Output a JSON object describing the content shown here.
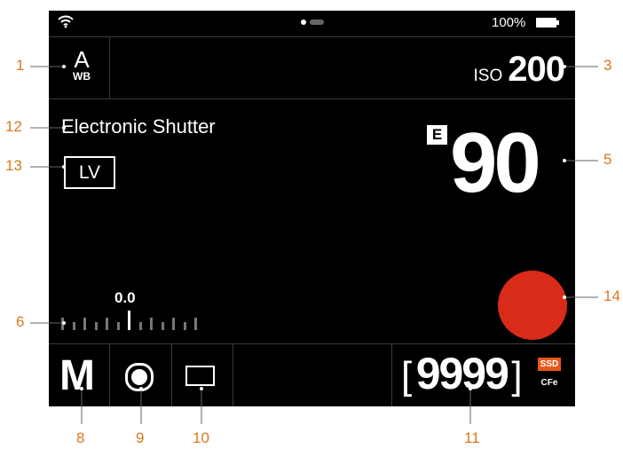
{
  "status_bar": {
    "wifi_icon": "wifi-icon",
    "battery_percent": "100%",
    "battery_icon": "battery-icon"
  },
  "white_balance": {
    "mode": "A",
    "label": "WB"
  },
  "iso": {
    "label": "ISO",
    "value": "200"
  },
  "shutter": {
    "mode_text": "Electronic Shutter",
    "live_view_label": "LV",
    "badge": "E",
    "speed": "90"
  },
  "exposure": {
    "compensation": "0.0"
  },
  "bottom_bar": {
    "exposure_mode": "M",
    "drive_icon": "single-shot-icon",
    "aspect_icon": "frame-format-icon",
    "shots_remaining": "9999",
    "bracket_open": "[",
    "bracket_close": "]",
    "media_primary": "SSD",
    "media_secondary": "CFe"
  },
  "callouts": {
    "c1": "1",
    "c3": "3",
    "c5": "5",
    "c6": "6",
    "c8": "8",
    "c9": "9",
    "c10": "10",
    "c11": "11",
    "c12": "12",
    "c13": "13",
    "c14": "14"
  },
  "colors": {
    "callout": "#d9781f",
    "record": "#d92b1a",
    "ssd_badge": "#e8571a",
    "background": "#000000"
  }
}
